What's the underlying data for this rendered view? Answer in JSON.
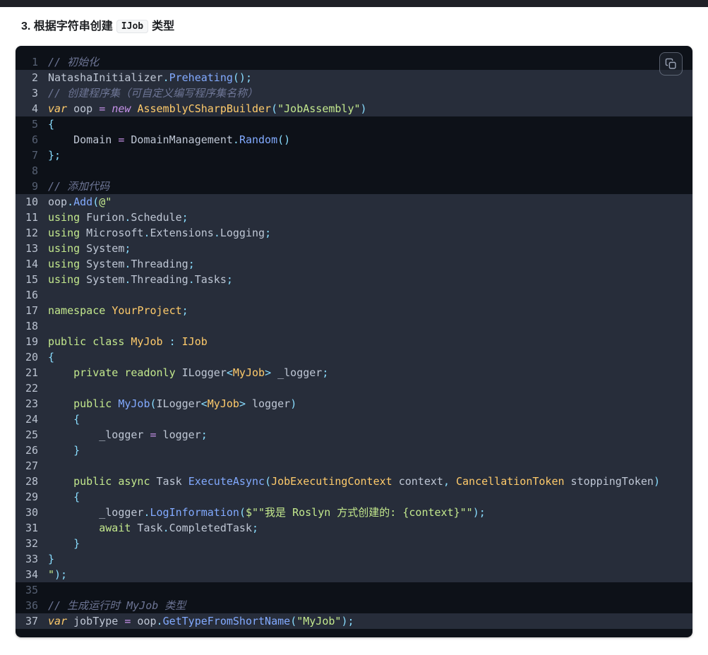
{
  "heading": {
    "prefix": "3. 根据字符串创建",
    "code": "IJob",
    "suffix": "类型"
  },
  "palette": {
    "plain": "#bfc7d5",
    "comment": "#6d7595",
    "keyword": "#c3e88d",
    "string": "#c3e88d",
    "func": "#82aaff",
    "class_name": "#ffcb6b",
    "punctuation": "#89ddff",
    "operator": "#c792ea",
    "var_kw": "#ffcb6b",
    "new_kw": "#c792ea",
    "code_background": "#0d1118",
    "highlight_background": "#272d3a"
  },
  "code": {
    "copy_icon": "copy-icon",
    "lines": [
      {
        "n": 1,
        "h": false,
        "tokens": [
          [
            "c",
            "// 初始化"
          ]
        ]
      },
      {
        "n": 2,
        "h": true,
        "tokens": [
          [
            "p",
            "NatashaInitializer"
          ],
          [
            "u",
            "."
          ],
          [
            "f",
            "Preheating"
          ],
          [
            "u",
            "();"
          ]
        ]
      },
      {
        "n": 3,
        "h": true,
        "tokens": [
          [
            "c",
            "// 创建程序集（可自定义编写程序集名称）"
          ]
        ]
      },
      {
        "n": 4,
        "h": true,
        "tokens": [
          [
            "v",
            "var"
          ],
          [
            "p",
            " oop "
          ],
          [
            "o",
            "="
          ],
          [
            "p",
            " "
          ],
          [
            "n",
            "new"
          ],
          [
            "p",
            " "
          ],
          [
            "t",
            "AssemblyCSharpBuilder"
          ],
          [
            "u",
            "("
          ],
          [
            "s",
            "\"JobAssembly\""
          ],
          [
            "u",
            ")"
          ]
        ]
      },
      {
        "n": 5,
        "h": false,
        "tokens": [
          [
            "u",
            "{"
          ]
        ]
      },
      {
        "n": 6,
        "h": false,
        "tokens": [
          [
            "p",
            "    Domain "
          ],
          [
            "o",
            "="
          ],
          [
            "p",
            " DomainManagement"
          ],
          [
            "u",
            "."
          ],
          [
            "f",
            "Random"
          ],
          [
            "u",
            "()"
          ]
        ]
      },
      {
        "n": 7,
        "h": false,
        "tokens": [
          [
            "u",
            "};"
          ]
        ]
      },
      {
        "n": 8,
        "h": false,
        "tokens": []
      },
      {
        "n": 9,
        "h": false,
        "tokens": [
          [
            "c",
            "// 添加代码"
          ]
        ]
      },
      {
        "n": 10,
        "h": true,
        "tokens": [
          [
            "p",
            "oop"
          ],
          [
            "u",
            "."
          ],
          [
            "f",
            "Add"
          ],
          [
            "u",
            "("
          ],
          [
            "s",
            "@\""
          ]
        ]
      },
      {
        "n": 11,
        "h": true,
        "tokens": [
          [
            "k",
            "using"
          ],
          [
            "p",
            " Furion"
          ],
          [
            "u",
            "."
          ],
          [
            "p",
            "Schedule"
          ],
          [
            "u",
            ";"
          ]
        ]
      },
      {
        "n": 12,
        "h": true,
        "tokens": [
          [
            "k",
            "using"
          ],
          [
            "p",
            " Microsoft"
          ],
          [
            "u",
            "."
          ],
          [
            "p",
            "Extensions"
          ],
          [
            "u",
            "."
          ],
          [
            "p",
            "Logging"
          ],
          [
            "u",
            ";"
          ]
        ]
      },
      {
        "n": 13,
        "h": true,
        "tokens": [
          [
            "k",
            "using"
          ],
          [
            "p",
            " System"
          ],
          [
            "u",
            ";"
          ]
        ]
      },
      {
        "n": 14,
        "h": true,
        "tokens": [
          [
            "k",
            "using"
          ],
          [
            "p",
            " System"
          ],
          [
            "u",
            "."
          ],
          [
            "p",
            "Threading"
          ],
          [
            "u",
            ";"
          ]
        ]
      },
      {
        "n": 15,
        "h": true,
        "tokens": [
          [
            "k",
            "using"
          ],
          [
            "p",
            " System"
          ],
          [
            "u",
            "."
          ],
          [
            "p",
            "Threading"
          ],
          [
            "u",
            "."
          ],
          [
            "p",
            "Tasks"
          ],
          [
            "u",
            ";"
          ]
        ]
      },
      {
        "n": 16,
        "h": true,
        "tokens": []
      },
      {
        "n": 17,
        "h": true,
        "tokens": [
          [
            "k",
            "namespace"
          ],
          [
            "p",
            " "
          ],
          [
            "t",
            "YourProject"
          ],
          [
            "u",
            ";"
          ]
        ]
      },
      {
        "n": 18,
        "h": true,
        "tokens": []
      },
      {
        "n": 19,
        "h": true,
        "tokens": [
          [
            "k",
            "public"
          ],
          [
            "p",
            " "
          ],
          [
            "k",
            "class"
          ],
          [
            "p",
            " "
          ],
          [
            "t",
            "MyJob"
          ],
          [
            "p",
            " "
          ],
          [
            "u",
            ":"
          ],
          [
            "p",
            " "
          ],
          [
            "t",
            "IJob"
          ]
        ]
      },
      {
        "n": 20,
        "h": true,
        "tokens": [
          [
            "u",
            "{"
          ]
        ]
      },
      {
        "n": 21,
        "h": true,
        "tokens": [
          [
            "p",
            "    "
          ],
          [
            "k",
            "private"
          ],
          [
            "p",
            " "
          ],
          [
            "k",
            "readonly"
          ],
          [
            "p",
            " ILogger"
          ],
          [
            "u",
            "<"
          ],
          [
            "t",
            "MyJob"
          ],
          [
            "u",
            ">"
          ],
          [
            "p",
            " _logger"
          ],
          [
            "u",
            ";"
          ]
        ]
      },
      {
        "n": 22,
        "h": true,
        "tokens": []
      },
      {
        "n": 23,
        "h": true,
        "tokens": [
          [
            "p",
            "    "
          ],
          [
            "k",
            "public"
          ],
          [
            "p",
            " "
          ],
          [
            "f",
            "MyJob"
          ],
          [
            "u",
            "("
          ],
          [
            "p",
            "ILogger"
          ],
          [
            "u",
            "<"
          ],
          [
            "t",
            "MyJob"
          ],
          [
            "u",
            ">"
          ],
          [
            "p",
            " logger"
          ],
          [
            "u",
            ")"
          ]
        ]
      },
      {
        "n": 24,
        "h": true,
        "tokens": [
          [
            "u",
            "    {"
          ]
        ]
      },
      {
        "n": 25,
        "h": true,
        "tokens": [
          [
            "p",
            "        _logger "
          ],
          [
            "o",
            "="
          ],
          [
            "p",
            " logger"
          ],
          [
            "u",
            ";"
          ]
        ]
      },
      {
        "n": 26,
        "h": true,
        "tokens": [
          [
            "u",
            "    }"
          ]
        ]
      },
      {
        "n": 27,
        "h": true,
        "tokens": []
      },
      {
        "n": 28,
        "h": true,
        "tokens": [
          [
            "p",
            "    "
          ],
          [
            "k",
            "public"
          ],
          [
            "p",
            " "
          ],
          [
            "k",
            "async"
          ],
          [
            "p",
            " Task "
          ],
          [
            "f",
            "ExecuteAsync"
          ],
          [
            "u",
            "("
          ],
          [
            "t",
            "JobExecutingContext"
          ],
          [
            "p",
            " context"
          ],
          [
            "u",
            ","
          ],
          [
            "p",
            " "
          ],
          [
            "t",
            "CancellationToken"
          ],
          [
            "p",
            " stoppingToken"
          ],
          [
            "u",
            ")"
          ]
        ]
      },
      {
        "n": 29,
        "h": true,
        "tokens": [
          [
            "u",
            "    {"
          ]
        ]
      },
      {
        "n": 30,
        "h": true,
        "tokens": [
          [
            "p",
            "        _logger"
          ],
          [
            "u",
            "."
          ],
          [
            "f",
            "LogInformation"
          ],
          [
            "u",
            "("
          ],
          [
            "s",
            "$\"\"我是 Roslyn 方式创建的: {context}\"\""
          ],
          [
            "u",
            ");"
          ]
        ]
      },
      {
        "n": 31,
        "h": true,
        "tokens": [
          [
            "p",
            "        "
          ],
          [
            "k",
            "await"
          ],
          [
            "p",
            " Task"
          ],
          [
            "u",
            "."
          ],
          [
            "p",
            "CompletedTask"
          ],
          [
            "u",
            ";"
          ]
        ]
      },
      {
        "n": 32,
        "h": true,
        "tokens": [
          [
            "u",
            "    }"
          ]
        ]
      },
      {
        "n": 33,
        "h": true,
        "tokens": [
          [
            "u",
            "}"
          ]
        ]
      },
      {
        "n": 34,
        "h": true,
        "tokens": [
          [
            "s",
            "\""
          ],
          [
            "u",
            ");"
          ]
        ]
      },
      {
        "n": 35,
        "h": false,
        "tokens": []
      },
      {
        "n": 36,
        "h": false,
        "tokens": [
          [
            "c",
            "// 生成运行时 MyJob 类型"
          ]
        ]
      },
      {
        "n": 37,
        "h": true,
        "tokens": [
          [
            "v",
            "var"
          ],
          [
            "p",
            " jobType "
          ],
          [
            "o",
            "="
          ],
          [
            "p",
            " oop"
          ],
          [
            "u",
            "."
          ],
          [
            "f",
            "GetTypeFromShortName"
          ],
          [
            "u",
            "("
          ],
          [
            "s",
            "\"MyJob\""
          ],
          [
            "u",
            ");"
          ]
        ]
      }
    ]
  }
}
